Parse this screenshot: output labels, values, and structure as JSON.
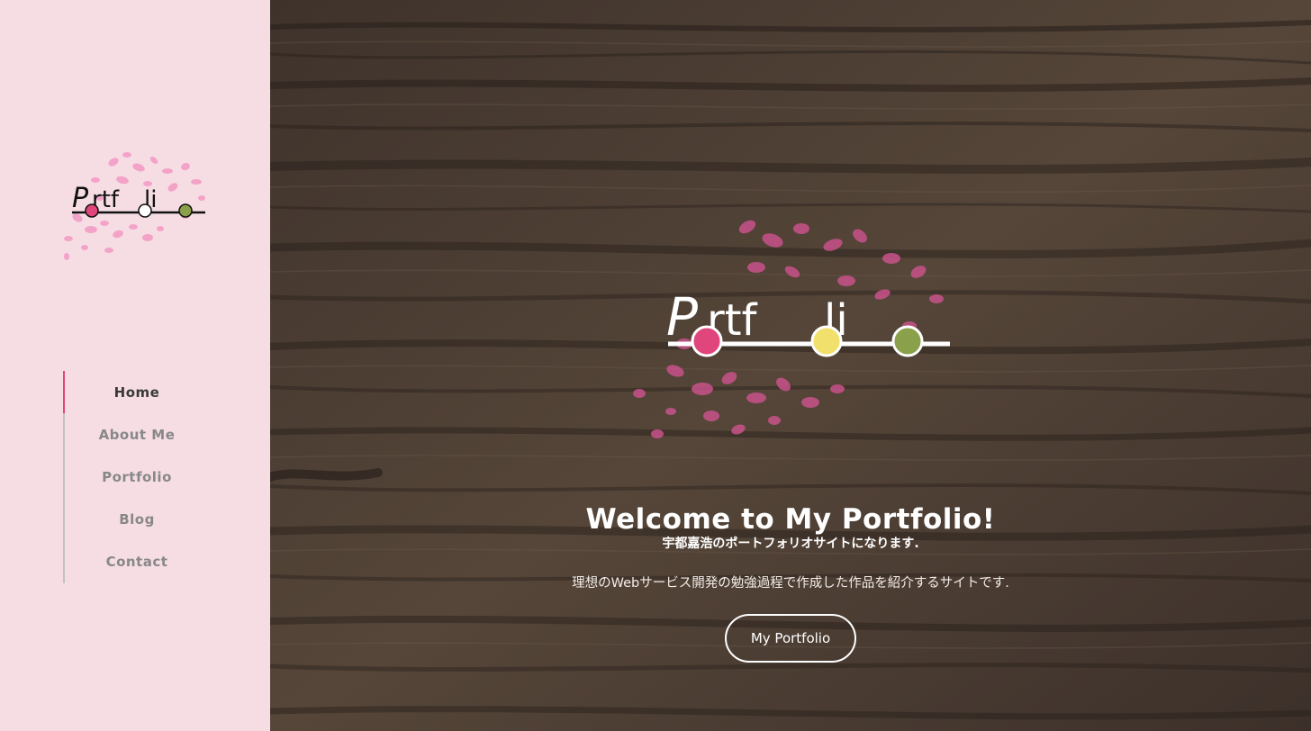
{
  "sidebar": {
    "logo": {
      "text": "Portfolio",
      "colors": {
        "blossom": "#f49ac4",
        "pink_dot": "#e0457b",
        "green_dot": "#8ba04a"
      }
    },
    "nav": [
      {
        "label": "Home",
        "active": true
      },
      {
        "label": "About Me",
        "active": false
      },
      {
        "label": "Portfolio",
        "active": false
      },
      {
        "label": "Blog",
        "active": false
      },
      {
        "label": "Contact",
        "active": false
      }
    ],
    "colors": {
      "background": "#f6dde4",
      "accent": "#e0457b"
    }
  },
  "hero": {
    "logo": {
      "text": "Portfolio",
      "colors": {
        "blossom": "#c8528a",
        "pink_dot": "#e0457b",
        "yellow_dot": "#f1e06c",
        "green_dot": "#8ba04a"
      }
    },
    "title": "Welcome to My Portfolio!",
    "subtitle": "宇都嘉浩のポートフォリオサイトになります.",
    "description": "理想のWebサービス開発の勉強過程で作成した作品を紹介するサイトです.",
    "cta_label": "My Portfolio",
    "background": "wood-texture"
  }
}
